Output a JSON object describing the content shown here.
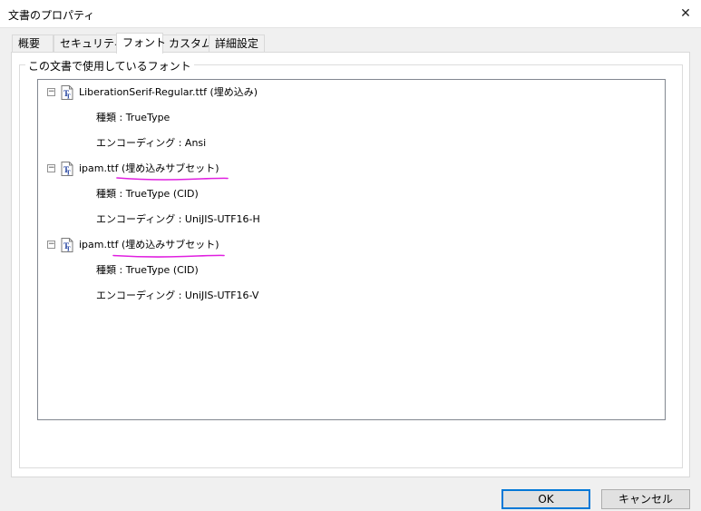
{
  "window": {
    "title": "文書のプロパティ",
    "close_glyph": "✕"
  },
  "tabs": [
    {
      "label": "概要"
    },
    {
      "label": "セキュリティ"
    },
    {
      "label": "フォント",
      "active": true
    },
    {
      "label": "カスタム"
    },
    {
      "label": "詳細設定"
    }
  ],
  "fonts_group": {
    "label": "この文書で使用しているフォント",
    "fonts": [
      {
        "name": "LiberationSerif-Regular.ttf (埋め込み)",
        "type_line": "種類 : TrueType",
        "encoding_line": "エンコーディング : Ansi",
        "highlighted": false
      },
      {
        "name": "ipam.ttf (埋め込みサブセット)",
        "type_line": "種類 : TrueType (CID)",
        "encoding_line": "エンコーディング : UniJIS-UTF16-H",
        "highlighted": true
      },
      {
        "name": "ipam.ttf (埋め込みサブセット)",
        "type_line": "種類 : TrueType (CID)",
        "encoding_line": "エンコーディング : UniJIS-UTF16-V",
        "highlighted": true
      }
    ]
  },
  "buttons": {
    "ok": "OK",
    "cancel": "キャンセル"
  },
  "colors": {
    "annotation": "#e020e0",
    "accent": "#0078d7",
    "icon": "#1c3c9c"
  },
  "icons": {
    "collapse": "minus-box-icon",
    "font_file": "truetype-font-icon"
  }
}
